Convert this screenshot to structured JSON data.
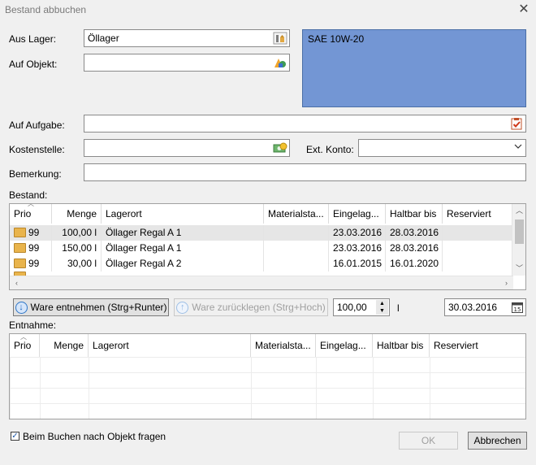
{
  "window": {
    "title": "Bestand abbuchen",
    "close": "✕"
  },
  "labels": {
    "aus_lager": "Aus Lager:",
    "auf_objekt": "Auf Objekt:",
    "auf_aufgabe": "Auf Aufgabe:",
    "kostenstelle": "Kostenstelle:",
    "ext_konto": "Ext. Konto:",
    "bemerkung": "Bemerkung:",
    "bestand": "Bestand:",
    "entnahme": "Entnahme:"
  },
  "fields": {
    "aus_lager": "Öllager",
    "auf_objekt": "",
    "auf_aufgabe": "",
    "kostenstelle": "",
    "ext_konto": "",
    "bemerkung": ""
  },
  "info_panel": {
    "text": "SAE 10W-20",
    "color": "#7396d4"
  },
  "bestand_table": {
    "columns": [
      "Prio",
      "Menge",
      "Lagerort",
      "Materialsta...",
      "Eingelag...",
      "Haltbar bis",
      "Reserviert"
    ],
    "rows": [
      {
        "prio": "99",
        "menge": "100,00 l",
        "lagerort": "Öllager Regal A 1",
        "material": "",
        "eingelagert": "23.03.2016",
        "haltbar": "28.03.2016",
        "reserviert": ""
      },
      {
        "prio": "99",
        "menge": "150,00 l",
        "lagerort": "Öllager Regal A 1",
        "material": "",
        "eingelagert": "23.03.2016",
        "haltbar": "28.03.2016",
        "reserviert": ""
      },
      {
        "prio": "99",
        "menge": "30,00 l",
        "lagerort": "Öllager Regal A 2",
        "material": "",
        "eingelagert": "16.01.2015",
        "haltbar": "16.01.2020",
        "reserviert": ""
      }
    ],
    "selected_row": 0
  },
  "actions": {
    "entnehmen": "Ware entnehmen (Strg+Runter)",
    "zuruecklegen": "Ware zurücklegen (Strg+Hoch)",
    "quantity": "100,00",
    "unit": "l",
    "date": "30.03.2016"
  },
  "entnahme_table": {
    "columns": [
      "Prio",
      "Menge",
      "Lagerort",
      "Materialsta...",
      "Eingelag...",
      "Haltbar bis",
      "Reserviert"
    ],
    "rows": []
  },
  "footer": {
    "checkbox_label": "Beim Buchen nach Objekt fragen",
    "checkbox_checked": true,
    "ok": "OK",
    "cancel": "Abbrechen"
  },
  "icons": {
    "close": "close-icon",
    "lager": "warehouse-icon",
    "objekt": "shapes-icon",
    "aufgabe": "task-icon",
    "kostenstelle": "money-icon",
    "folder": "folder-icon",
    "calendar": "calendar-icon"
  },
  "colors": {
    "selection": "#e6e6e6",
    "accent": "#2f77c8"
  }
}
